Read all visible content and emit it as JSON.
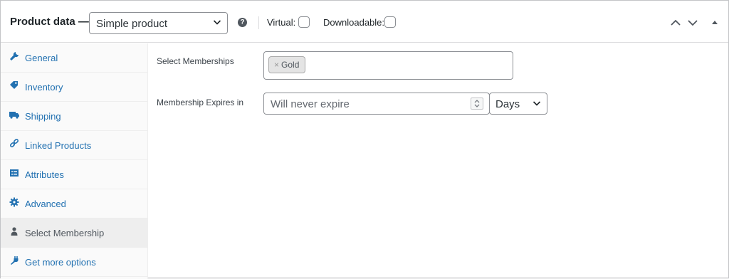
{
  "header": {
    "title": "Product data —",
    "product_type": "Simple product",
    "help_icon": "question-circle-icon",
    "virtual_label": "Virtual:",
    "virtual_checked": false,
    "downloadable_label": "Downloadable:",
    "downloadable_checked": false,
    "controls": [
      "move-up-icon",
      "move-down-icon",
      "collapse-toggle-icon"
    ]
  },
  "sidebar": {
    "items": [
      {
        "label": "General",
        "icon": "wrench-icon",
        "active": false
      },
      {
        "label": "Inventory",
        "icon": "tag-icon",
        "active": false
      },
      {
        "label": "Shipping",
        "icon": "truck-icon",
        "active": false
      },
      {
        "label": "Linked Products",
        "icon": "link-icon",
        "active": false
      },
      {
        "label": "Attributes",
        "icon": "list-icon",
        "active": false
      },
      {
        "label": "Advanced",
        "icon": "gear-icon",
        "active": false
      },
      {
        "label": "Select Membership",
        "icon": "person-icon",
        "active": true
      },
      {
        "label": "Get more options",
        "icon": "plugin-icon",
        "active": false
      }
    ]
  },
  "main": {
    "memberships_label": "Select Memberships",
    "memberships_selected": [
      "Gold"
    ],
    "chip_remove": "×",
    "expires_label": "Membership Expires in",
    "expires_placeholder": "Will never expire",
    "expires_unit": "Days"
  },
  "colors": {
    "link": "#2271b1",
    "active_tab_bg": "#eeeeee",
    "border": "#8c8f94"
  }
}
